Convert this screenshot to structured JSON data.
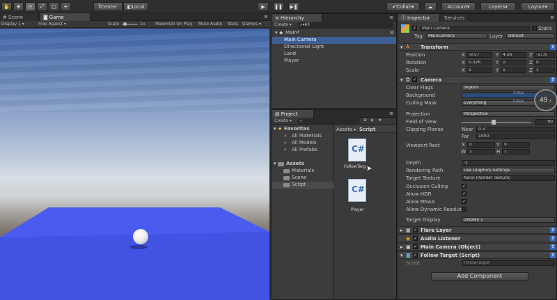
{
  "toolbar": {
    "pivot_label": "Center",
    "space_label": "Local",
    "collab_label": "Collab",
    "account_label": "Account",
    "layers_label": "Layers",
    "layout_label": "Layout"
  },
  "scene_view": {
    "scene_tab": "Scene",
    "game_tab": "Game",
    "display": "Display 1",
    "aspect": "Free Aspect",
    "scale_label": "Scale",
    "scale_value": "1x",
    "maximize": "Maximize On Play",
    "mute": "Mute Audio",
    "stats": "Stats",
    "gizmos": "Gizmos"
  },
  "hierarchy": {
    "tab": "Hierarchy",
    "create": "Create",
    "search": "All",
    "scene_name": "Main*",
    "items": [
      "Main Camera",
      "Directional Light",
      "Land",
      "Player"
    ]
  },
  "project": {
    "tab": "Project",
    "create": "Create",
    "favorites_label": "Favorites",
    "favorites": [
      "All Materials",
      "All Models",
      "All Prefabs"
    ],
    "assets_label": "Assets",
    "folders": [
      "Materials",
      "Scene",
      "Script"
    ],
    "breadcrumb_root": "Assets",
    "breadcrumb_leaf": "Script",
    "files": [
      "FollowTarg",
      "Player"
    ]
  },
  "inspector": {
    "tab": "Inspector",
    "services_tab": "Services",
    "object_name": "Main Camera",
    "static_label": "Static",
    "tag_label": "Tag",
    "tag_value": "MainCamera",
    "layer_label": "Layer",
    "layer_value": "Default",
    "transform": {
      "title": "Transform",
      "position_label": "Position",
      "position": [
        "-0.57",
        "4.56",
        "-17.6"
      ],
      "rotation_label": "Rotation",
      "rotation": [
        "0.026",
        "0",
        "0"
      ],
      "scale_label": "Scale",
      "scale": [
        "1",
        "1",
        "1"
      ]
    },
    "camera": {
      "title": "Camera",
      "clear_flags_label": "Clear Flags",
      "clear_flags": "Skybox",
      "background_label": "Background",
      "culling_label": "Culling Mask",
      "culling": "Everything",
      "projection_label": "Projection",
      "projection": "Perspective",
      "fov_label": "Field of View",
      "fov": "60",
      "clipping_label": "Clipping Planes",
      "near_label": "Near",
      "near": "0.3",
      "far_label": "Far",
      "far": "1000",
      "viewport_label": "Viewport Rect",
      "vx": "0",
      "vy": "0",
      "vw": "1",
      "vh": "1",
      "depth_label": "Depth",
      "depth": "-1",
      "rendering_label": "Rendering Path",
      "rendering": "Use Graphics Settings",
      "target_tex_label": "Target Texture",
      "target_tex": "None (Render Texture)",
      "occlusion_label": "Occlusion Culling",
      "hdr_label": "Allow HDR",
      "msaa_label": "Allow MSAA",
      "dyn_label": "Allow Dynamic Resoluti",
      "target_display_label": "Target Display",
      "target_display": "Display 1"
    },
    "components": [
      "Flare Layer",
      "Audio Listener",
      "Main Camera (Object)",
      "Follow Target (Script)"
    ],
    "script_label": "Script",
    "script_value": "FollowTarget",
    "add_component": "Add Component",
    "fps_badge": "49",
    "fps_unit": "x",
    "stat1": "2.2k/s",
    "stat2": "0.4k/s"
  }
}
